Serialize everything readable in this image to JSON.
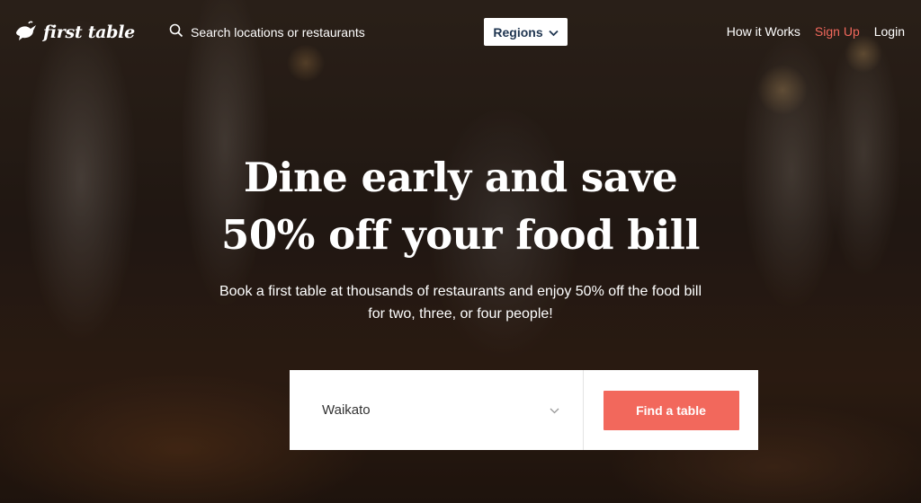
{
  "brand": {
    "name": "first table"
  },
  "search": {
    "placeholder": "Search locations or restaurants"
  },
  "regions_button": {
    "label": "Regions"
  },
  "nav": {
    "how_it_works": "How it Works",
    "sign_up": "Sign Up",
    "login": "Login"
  },
  "hero": {
    "headline_line1": "Dine early and save",
    "headline_line2": "50% off your food bill",
    "subtext_line1": "Book a first table at thousands of restaurants and enjoy 50% off the food bill",
    "subtext_line2": "for two, three, or four people!"
  },
  "booking": {
    "selected_region": "Waikato",
    "cta_label": "Find a table"
  },
  "colors": {
    "accent": "#f2685c",
    "regions_text": "#1f3550"
  },
  "icons": [
    "bird-logo-icon",
    "search-icon",
    "chevron-down-icon"
  ]
}
